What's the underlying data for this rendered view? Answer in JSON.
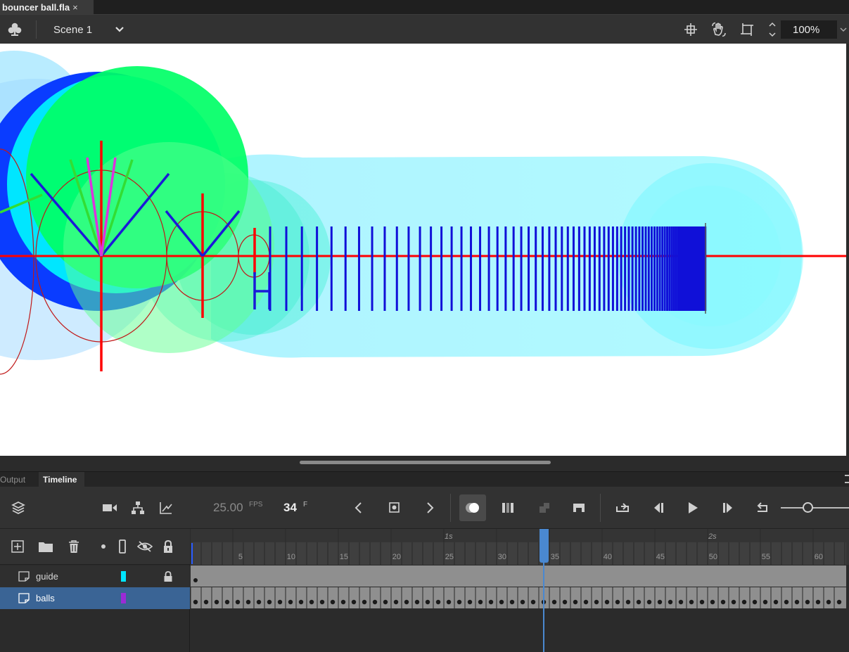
{
  "document": {
    "tab_title": "bouncer ball.fla",
    "close_glyph": "×"
  },
  "editbar": {
    "scene_name": "Scene 1",
    "zoom_value": "100%",
    "icons": [
      "symbol-clubs-icon",
      "chevron-down-icon",
      "center-stage-icon",
      "hand-rotate-icon",
      "clip-canvas-icon",
      "stepper-icon"
    ]
  },
  "panel_tabs": {
    "output": "Output",
    "timeline": "Timeline",
    "active": "Timeline"
  },
  "timeline": {
    "fps": "25.00",
    "fps_unit": "FPS",
    "current_frame": "34",
    "frame_unit": "F",
    "ruler_ticks": [
      "5",
      "10",
      "15",
      "20",
      "25",
      "30",
      "35",
      "40",
      "45",
      "50",
      "55",
      "60"
    ],
    "time_marks": [
      "1s",
      "2s"
    ],
    "playhead_frame": 34,
    "guide_keyframes": [
      1
    ],
    "balls_keyframe_count": 62
  },
  "layers": [
    {
      "name": "guide",
      "color": "#00e5ff",
      "locked": true,
      "selected": false
    },
    {
      "name": "balls",
      "color": "#9b2bd6",
      "locked": false,
      "selected": true
    }
  ],
  "colors": {
    "accent": "#4a88d0",
    "selected_layer": "#3a6495",
    "guide_line": "#ff0000",
    "tick_blue": "#1010d8",
    "ball_cyan": "#5ef2ff",
    "ball_green": "#00ff66"
  }
}
